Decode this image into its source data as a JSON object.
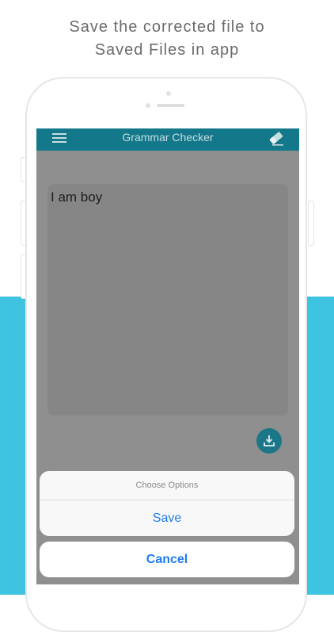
{
  "caption": {
    "line1": "Save the corrected file to",
    "line2": "Saved Files in app"
  },
  "colors": {
    "background_band": "#3ec3e0",
    "navbar": "#13788a",
    "accent_blue": "#1d7cf2"
  },
  "app": {
    "title": "Grammar Checker",
    "menu_icon": "hamburger-menu-icon",
    "eraser_icon": "eraser-icon",
    "editor_text": "I am boy",
    "download_icon": "download-icon"
  },
  "action_sheet": {
    "title": "Choose Options",
    "save_label": "Save",
    "cancel_label": "Cancel"
  }
}
